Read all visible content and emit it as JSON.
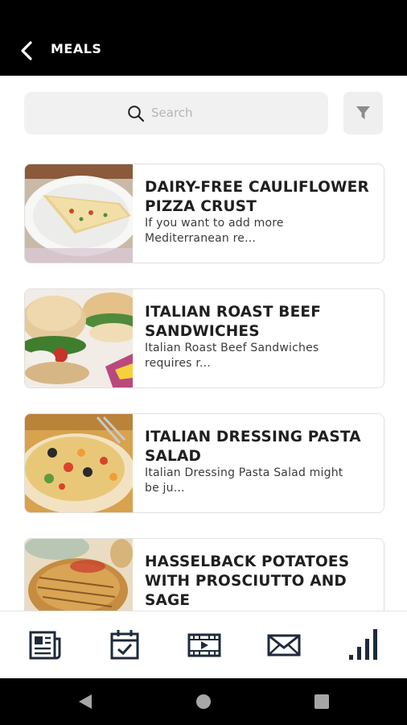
{
  "header": {
    "title": "MEALS"
  },
  "search": {
    "placeholder": "Search"
  },
  "meals": [
    {
      "title": "DAIRY-FREE CAULIFLOWER PIZZA CRUST",
      "description": "If you want to add more Mediterranean re..."
    },
    {
      "title": "ITALIAN ROAST BEEF SANDWICHES",
      "description": "Italian Roast Beef Sandwiches requires r..."
    },
    {
      "title": "ITALIAN DRESSING PASTA SALAD",
      "description": "Italian Dressing Pasta Salad might be ju..."
    },
    {
      "title": "HASSELBACK POTATOES WITH PROSCIUTTO AND SAGE",
      "description": ""
    }
  ],
  "bottom_nav": [
    {
      "icon": "news-icon"
    },
    {
      "icon": "calendar-check-icon"
    },
    {
      "icon": "video-icon"
    },
    {
      "icon": "mail-icon"
    },
    {
      "icon": "stats-icon"
    }
  ],
  "system_nav": [
    {
      "icon": "back-triangle-icon"
    },
    {
      "icon": "home-circle-icon"
    },
    {
      "icon": "recents-square-icon"
    }
  ]
}
